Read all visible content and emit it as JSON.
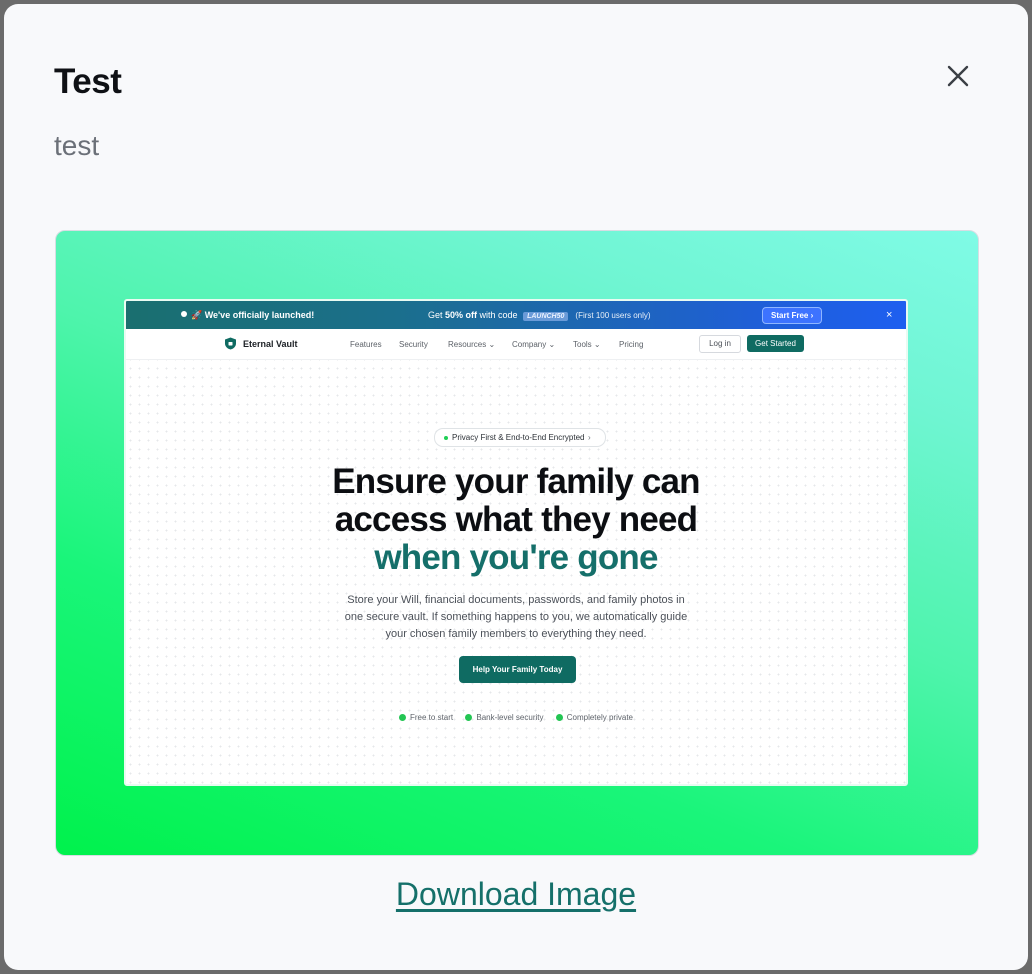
{
  "modal": {
    "title": "Test",
    "subtitle": "test",
    "close_icon": "close-icon",
    "download_label": "Download Image"
  },
  "preview": {
    "promo": {
      "launch_text": "🚀 We've officially launched!",
      "offer_prefix": "Get ",
      "offer_bold": "50% off",
      "offer_middle": " with code ",
      "code": "LAUNCH50",
      "offer_suffix": "(First 100 users only)",
      "cta": "Start Free",
      "close": "×"
    },
    "nav": {
      "brand": "Eternal Vault",
      "links": [
        "Features",
        "Security",
        "Resources",
        "Company",
        "Tools",
        "Pricing"
      ],
      "login": "Log in",
      "get_started": "Get Started"
    },
    "badge": "Privacy First & End-to-End Encrypted",
    "hero": {
      "line1": "Ensure your family can",
      "line2": "access what they need",
      "line3": "when you're gone"
    },
    "description": {
      "line1": "Store your Will, financial documents, passwords, and family photos in",
      "line2": "one secure vault. If something happens to you, we automatically guide",
      "line3": "your chosen family members to everything they need."
    },
    "cta": "Help Your Family Today",
    "features": [
      "Free to start",
      "Bank-level security",
      "Completely private"
    ]
  },
  "colors": {
    "accent": "#15706a",
    "gradient_start": "#00f24c",
    "gradient_end": "#80fbe6"
  }
}
